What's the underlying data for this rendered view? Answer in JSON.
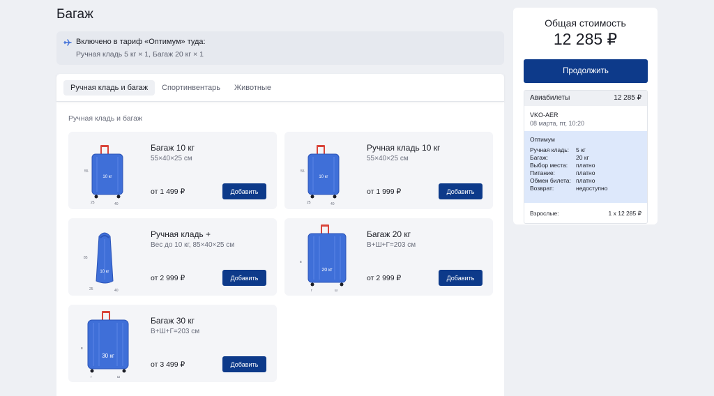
{
  "page": {
    "title": "Багаж"
  },
  "included": {
    "line1": "Включено в тариф «Оптимум» туда:",
    "line2": "Ручная кладь 5 кг × 1, Багаж 20 кг × 1"
  },
  "tabs": [
    {
      "label": "Ручная кладь и багаж",
      "active": true
    },
    {
      "label": "Спортинвентарь",
      "active": false
    },
    {
      "label": "Животные",
      "active": false
    }
  ],
  "section_label": "Ручная кладь и багаж",
  "add_label": "Добавить",
  "cards": [
    {
      "name": "Багаж 10 кг",
      "dims": "55×40×25 см",
      "price": "от 1 499 ₽",
      "icon": "suitcase-10kg-icon",
      "tag": "10 кг",
      "dim_labels": [
        "55",
        "25",
        "40"
      ]
    },
    {
      "name": "Ручная кладь 10 кг",
      "dims": "55×40×25 см",
      "price": "от 1 999 ₽",
      "icon": "suitcase-10kg-icon",
      "tag": "10 кг",
      "dim_labels": [
        "55",
        "25",
        "40"
      ]
    },
    {
      "name": "Ручная кладь +",
      "dims": "Вес до 10 кг, 85×40×25 см",
      "price": "от 2 999 ₽",
      "icon": "bag-10kg-icon",
      "tag": "10 кг",
      "dim_labels": [
        "85",
        "25",
        "40"
      ]
    },
    {
      "name": "Багаж 20 кг",
      "dims": "В+Ш+Г=203 см",
      "price": "от 2 999 ₽",
      "icon": "suitcase-20kg-icon",
      "tag": "20 кг",
      "dim_labels": [
        "в",
        "г",
        "ш"
      ]
    },
    {
      "name": "Багаж 30 кг",
      "dims": "В+Ш+Г=203 см",
      "price": "от 3 499 ₽",
      "icon": "suitcase-30kg-icon",
      "tag": "30 кг",
      "dim_labels": [
        "в",
        "г",
        "ш"
      ]
    }
  ],
  "summary": {
    "total_label": "Общая стоимость",
    "total_value": "12 285 ₽",
    "continue_label": "Продолжить",
    "tickets_label": "Авиабилеты",
    "tickets_value": "12 285 ₽",
    "route": "VKO-AER",
    "date": "08 марта, пт, 10:20",
    "tariff_name": "Оптимум",
    "tariff_rows": [
      {
        "label": "Ручная кладь:",
        "value": "5 кг"
      },
      {
        "label": "Багаж:",
        "value": "20 кг"
      },
      {
        "label": "Выбор места:",
        "value": "платно"
      },
      {
        "label": "Питание:",
        "value": "платно"
      },
      {
        "label": "Обмен билета:",
        "value": "платно"
      },
      {
        "label": "Возврат:",
        "value": "недоступно"
      }
    ],
    "passengers_label": "Взрослые:",
    "passengers_value": "1 x 12 285 ₽"
  },
  "colors": {
    "accent": "#0d3a8a",
    "luggage": "#3f6fd8",
    "handle": "#d9453b",
    "tariff_bg": "#dde8fb"
  }
}
